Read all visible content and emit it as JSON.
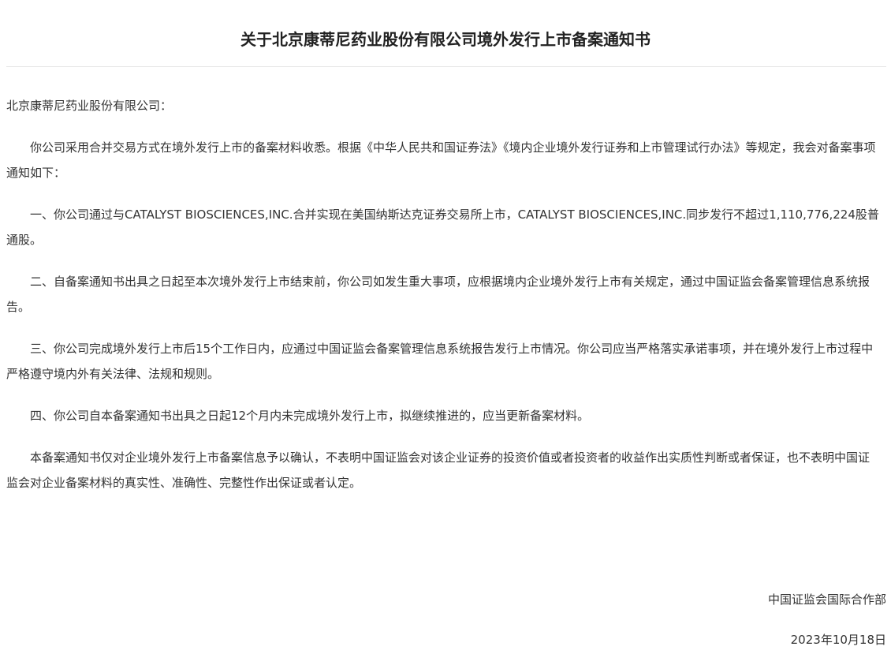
{
  "document": {
    "title": "关于北京康蒂尼药业股份有限公司境外发行上市备案通知书",
    "salutation": "北京康蒂尼药业股份有限公司：",
    "paragraphs": [
      "你公司采用合并交易方式在境外发行上市的备案材料收悉。根据《中华人民共和国证券法》《境内企业境外发行证券和上市管理试行办法》等规定，我会对备案事项通知如下：",
      "一、你公司通过与CATALYST BIOSCIENCES,INC.合并实现在美国纳斯达克证券交易所上市，CATALYST BIOSCIENCES,INC.同步发行不超过1,110,776,224股普通股。",
      "二、自备案通知书出具之日起至本次境外发行上市结束前，你公司如发生重大事项，应根据境内企业境外发行上市有关规定，通过中国证监会备案管理信息系统报告。",
      "三、你公司完成境外发行上市后15个工作日内，应通过中国证监会备案管理信息系统报告发行上市情况。你公司应当严格落实承诺事项，并在境外发行上市过程中严格遵守境内外有关法律、法规和规则。",
      "四、你公司自本备案通知书出具之日起12个月内未完成境外发行上市，拟继续推进的，应当更新备案材料。",
      "本备案通知书仅对企业境外发行上市备案信息予以确认，不表明中国证监会对该企业证券的投资价值或者投资者的收益作出实质性判断或者保证，也不表明中国证监会对企业备案材料的真实性、准确性、完整性作出保证或者认定。"
    ],
    "signature": "中国证监会国际合作部",
    "date": "2023年10月18日"
  }
}
